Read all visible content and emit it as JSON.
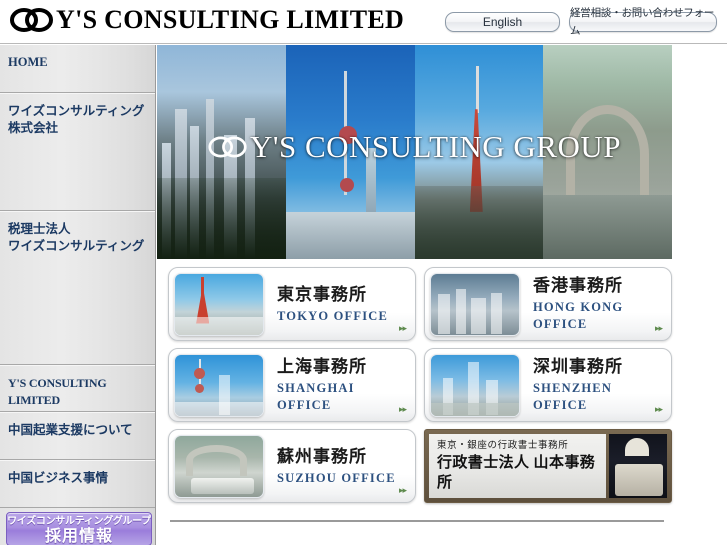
{
  "header": {
    "logo_text": "Y'S CONSULTING LIMITED",
    "logo_icon": "double-ring-logo-icon",
    "buttons": {
      "english": "English",
      "contact": "経営相談・お問い合わせフォーム"
    }
  },
  "sidebar": {
    "items": [
      {
        "label": "HOME",
        "sub": ""
      },
      {
        "label": "ワイズコンサルティング",
        "sub": "株式会社"
      },
      {
        "label": "税理士法人",
        "sub": "ワイズコンサルティング"
      },
      {
        "label": "Y'S CONSULTING LIMITED",
        "sub": ""
      },
      {
        "label": "中国起業支援について",
        "sub": ""
      },
      {
        "label": "中国ビジネス事情",
        "sub": ""
      }
    ],
    "promo": {
      "line1": "ワイズコンサルティンググループ",
      "line2": "採用情報"
    }
  },
  "hero": {
    "title": "Y'S CONSULTING GROUP",
    "logo_icon": "double-ring-logo-icon",
    "panes": [
      {
        "name": "hong-kong-skyline"
      },
      {
        "name": "shanghai-pudong-skyline"
      },
      {
        "name": "tokyo-tower-skyline"
      },
      {
        "name": "suzhou-canal-bridge"
      }
    ]
  },
  "offices": [
    {
      "ja": "東京事務所",
      "en": "TOKYO OFFICE",
      "thumb": "tokyo-tower-thumb",
      "arrow": "▸▸"
    },
    {
      "ja": "香港事務所",
      "en": "HONG KONG OFFICE",
      "thumb": "hong-kong-thumb",
      "arrow": "▸▸"
    },
    {
      "ja": "上海事務所",
      "en": "SHANGHAI OFFICE",
      "thumb": "shanghai-thumb",
      "arrow": "▸▸"
    },
    {
      "ja": "深圳事務所",
      "en": "SHENZHEN OFFICE",
      "thumb": "shenzhen-thumb",
      "arrow": "▸▸"
    },
    {
      "ja": "蘇州事務所",
      "en": "SUZHOU OFFICE",
      "thumb": "suzhou-thumb",
      "arrow": "▸▸"
    }
  ],
  "banner": {
    "line1": "東京・銀座の行政書士事務所",
    "line2": "行政書士法人 山本事務所",
    "image": "ginza-building-night-photo"
  },
  "colors": {
    "nav_text": "#1c3a63",
    "card_en_text": "#2d5180",
    "promo_purple": "#9a7ddb",
    "arrow_green": "#5e8a4e"
  }
}
